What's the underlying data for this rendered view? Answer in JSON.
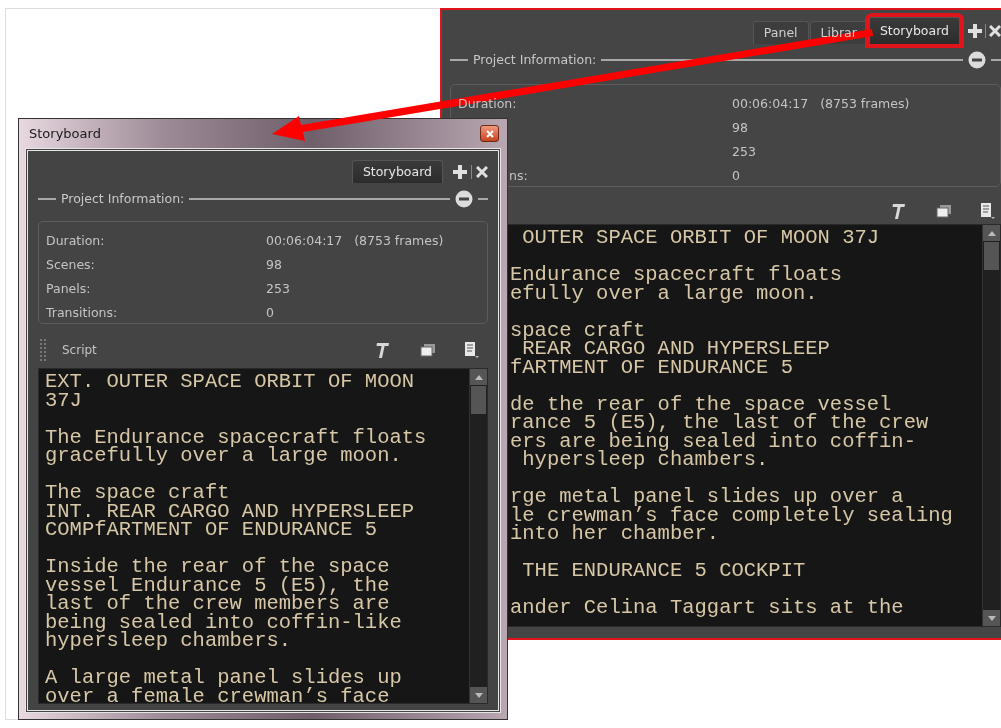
{
  "back_panel": {
    "tabs": [
      {
        "label": "Panel",
        "selected": false,
        "highlighted": false
      },
      {
        "label": "Librar",
        "selected": false,
        "highlighted": false
      },
      {
        "label": "Storyboard",
        "selected": true,
        "highlighted": true
      }
    ],
    "section_title": "Project Information:",
    "info_rows": [
      {
        "label": "Duration:",
        "value": "00:06:04:17",
        "extra": "(8753 frames)"
      },
      {
        "value": "98"
      },
      {
        "value": "253"
      },
      {
        "label": "ns:",
        "value": "0"
      }
    ],
    "script_paragraphs": [
      [
        " OUTER SPACE ORBIT OF MOON 37J"
      ],
      [
        "Endurance spacecraft floats",
        "efully over a large moon."
      ],
      [
        "space craft",
        " REAR CARGO AND HYPERSLEEP",
        "fARTMENT OF ENDURANCE 5"
      ],
      [
        "de the rear of the space vessel",
        "rance 5 (E5), the last of the crew",
        "ers are being sealed into coffin-",
        " hypersleep chambers."
      ],
      [
        "rge metal panel slides up over a",
        "le crewman’s face completely sealing",
        "into her chamber."
      ],
      [
        " THE ENDURANCE 5 COCKPIT"
      ],
      [
        "ander Celina Taggart sits at the"
      ]
    ]
  },
  "front_window": {
    "title": "Storyboard",
    "tabs": [
      {
        "label": "Storyboard",
        "selected": true
      }
    ],
    "section_title": "Project Information:",
    "info_rows": [
      {
        "label": "Duration:",
        "value": "00:06:04:17",
        "extra": "(8753 frames)"
      },
      {
        "label": "Scenes:",
        "value": "98"
      },
      {
        "label": "Panels:",
        "value": "253"
      },
      {
        "label": "Transitions:",
        "value": "0"
      }
    ],
    "script_title": "Script",
    "script_paragraphs": [
      [
        "EXT. OUTER SPACE ORBIT OF MOON",
        "37J"
      ],
      [
        "The Endurance spacecraft floats",
        "gracefully over a large moon."
      ],
      [
        "The space craft",
        "INT. REAR CARGO AND HYPERSLEEP",
        "COMPfARTMENT OF ENDURANCE 5"
      ],
      [
        "Inside the rear of the space",
        "vessel Endurance 5 (E5), the",
        "last of the crew members are",
        "being sealed into coffin-like",
        "hypersleep chambers."
      ],
      [
        "A large metal panel slides up",
        "over a female crewman’s face"
      ]
    ]
  }
}
